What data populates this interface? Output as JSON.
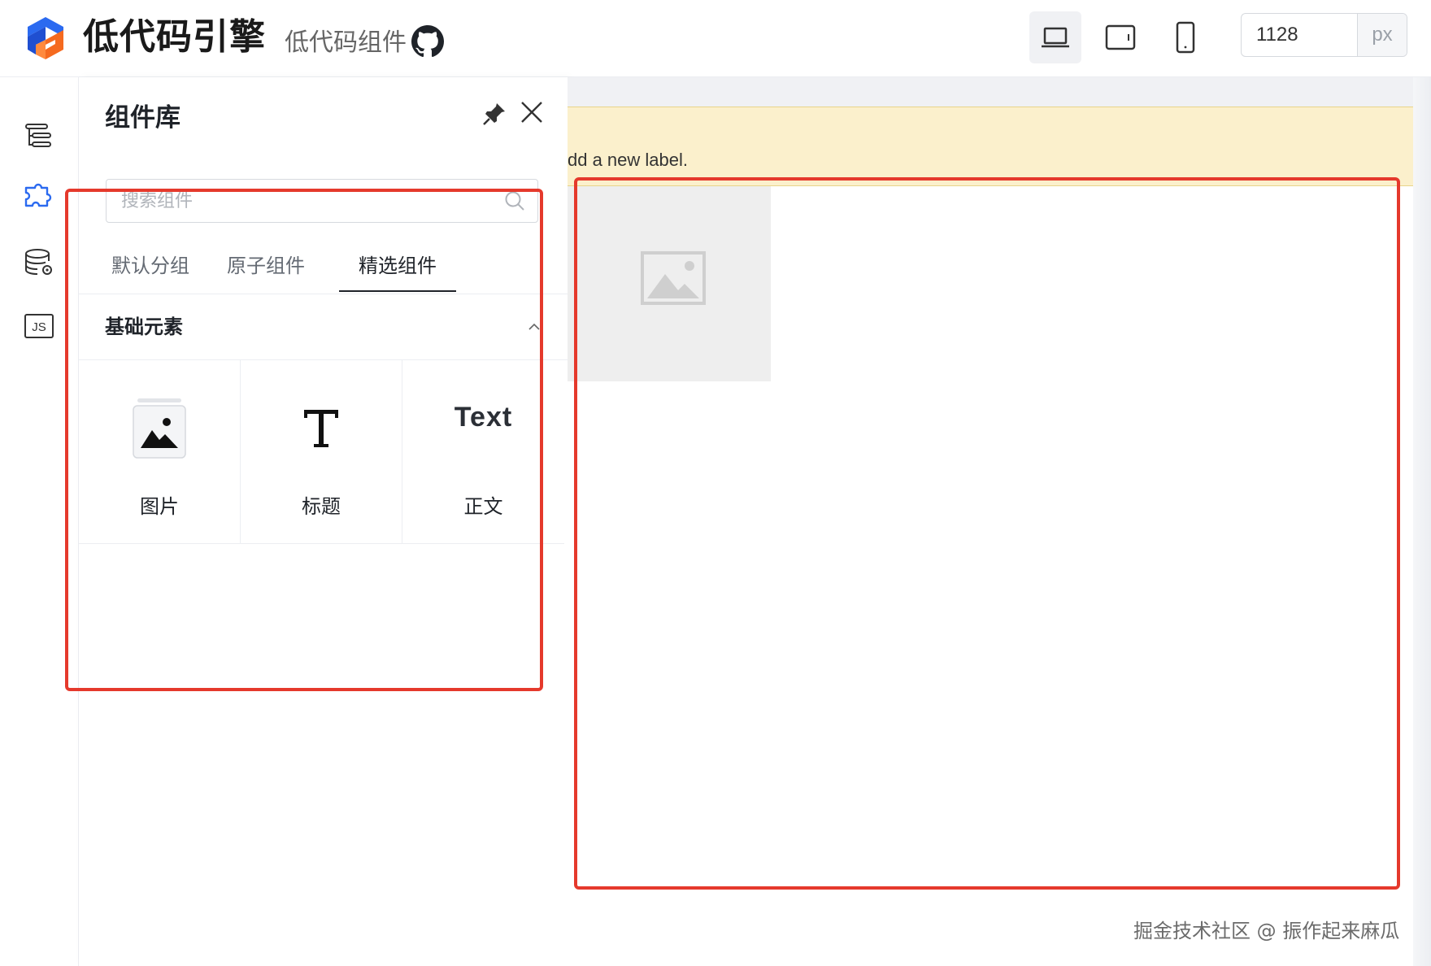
{
  "header": {
    "brand": "低代码引擎",
    "subtitle": "低代码组件",
    "icons": [
      "brand-logo",
      "github-icon"
    ]
  },
  "device_switcher": {
    "options": [
      "desktop",
      "tablet",
      "mobile"
    ],
    "active": "desktop"
  },
  "canvas_width": {
    "value": "1128",
    "unit": "px"
  },
  "rail": {
    "items": [
      "outline-tree-icon",
      "components-icon",
      "datasource-icon",
      "js-code-icon"
    ],
    "active": "components-icon",
    "js_label": "JS"
  },
  "panel": {
    "title": "组件库",
    "search_placeholder": "搜索组件",
    "tabs": [
      {
        "label": "默认分组"
      },
      {
        "label": "原子组件"
      },
      {
        "label": "精选组件"
      }
    ],
    "active_tab": "精选组件",
    "group": {
      "title": "基础元素",
      "items": [
        {
          "label": "图片",
          "icon": "image-icon"
        },
        {
          "label": "标题",
          "icon": "title-T-icon"
        },
        {
          "label": "正文",
          "icon": "text-icon",
          "glyph": "Text"
        }
      ]
    }
  },
  "canvas": {
    "notice": "dd a new label.",
    "placeholder_icon": "image-placeholder-icon"
  },
  "colors": {
    "highlight": "#e5392c",
    "notice_bg": "#fbf0cc",
    "accent": "#2b6af0"
  },
  "watermark": "掘金技术社区 @ 振作起来麻瓜"
}
